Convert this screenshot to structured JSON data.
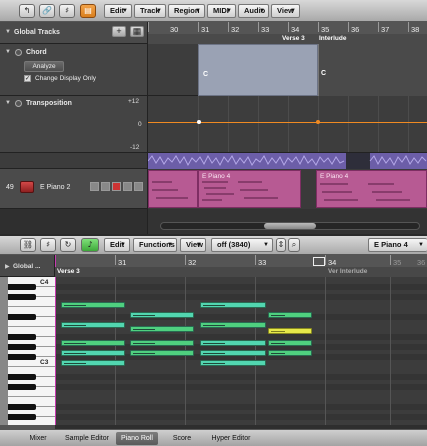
{
  "top_toolbar": {
    "buttons": [
      "↰",
      "🔗",
      "♯",
      "▤"
    ],
    "menus": [
      "Edit",
      "Track",
      "Region",
      "MIDI",
      "Audio",
      "View"
    ]
  },
  "global_tracks": {
    "title": "Global Tracks",
    "add": "+",
    "chord_track": {
      "label": "Chord",
      "analyze": "Analyze",
      "change_display_only": "Change Display Only",
      "checked": true
    },
    "transposition_track": {
      "label": "Transposition",
      "max": "+12",
      "zero": "0",
      "min": "-12"
    }
  },
  "arrange_ruler": {
    "bars": [
      "30",
      "31",
      "32",
      "33",
      "34",
      "35",
      "36",
      "37",
      "38"
    ],
    "markers": [
      "Verse 3",
      "Interlude"
    ]
  },
  "chord_regions": [
    {
      "label": "C"
    },
    {
      "label": "C"
    }
  ],
  "instrument_track": {
    "number": "49",
    "name": "E Piano 2",
    "regions": [
      "E Piano 4",
      "E Piano 4"
    ]
  },
  "piano_roll_toolbar": {
    "menus": [
      "Edit",
      "Functions",
      "View"
    ],
    "quantize": "off (3840)",
    "region_name": "E Piano 4"
  },
  "piano_roll": {
    "global_label": "Global ...",
    "bars": [
      "31",
      "32",
      "33",
      "34",
      "35",
      "36"
    ],
    "markers": [
      "Verse 3",
      "Ver Interlude"
    ],
    "octave_labels": [
      "C4",
      "C3"
    ],
    "colors": {
      "note_green": "#4fd07f",
      "note_teal": "#52d6b0",
      "note_yellow": "#e6e84a",
      "playhead": "#c83ab0"
    }
  },
  "bottom_tabs": [
    "Mixer",
    "Sample Editor",
    "Piano Roll",
    "Score",
    "Hyper Editor"
  ],
  "selected_tab": "Piano Roll"
}
